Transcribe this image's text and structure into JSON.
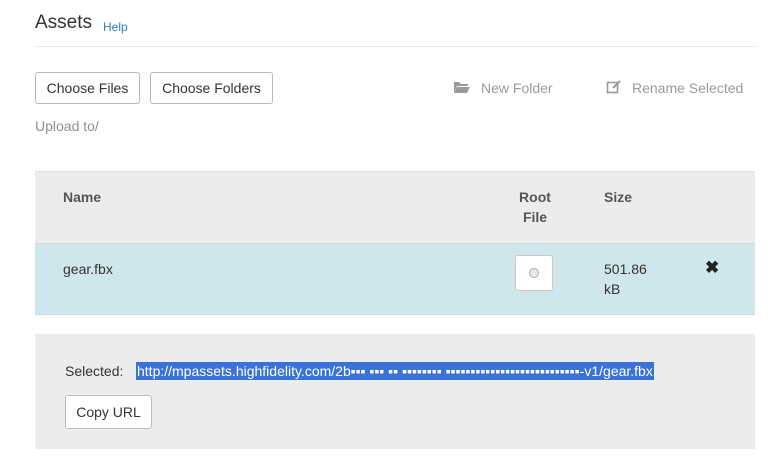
{
  "header": {
    "title": "Assets",
    "help": "Help"
  },
  "toolbar": {
    "choose_files": "Choose Files",
    "choose_folders": "Choose Folders",
    "new_folder": "New Folder",
    "rename_selected": "Rename Selected"
  },
  "upload_to": "Upload to/",
  "table": {
    "columns": {
      "name": "Name",
      "root_line1": "Root",
      "root_line2": "File",
      "size": "Size"
    },
    "rows": [
      {
        "name": "gear.fbx",
        "size_line1": "501.86",
        "size_line2": "kB",
        "root_file_selected": false
      }
    ]
  },
  "selection": {
    "label": "Selected:",
    "url": "http://mpassets.highfidelity.com/2b▪▪▪ ▪▪▪ ▪▪ ▪▪▪▪▪▪▪▪ ▪▪▪▪▪▪▪▪▪▪▪▪▪▪▪▪▪▪▪▪▪▪▪▪▪▪▪-v1/gear.fbx",
    "copy_url": "Copy URL"
  },
  "icons": {
    "folder": "folder-open-icon",
    "rename": "edit-icon",
    "delete": "close-icon",
    "radio": "radio-icon"
  },
  "colors": {
    "accent": "#2f7fbf",
    "selected_row": "#cfe7ec",
    "selection_highlight": "#3a73d8"
  }
}
